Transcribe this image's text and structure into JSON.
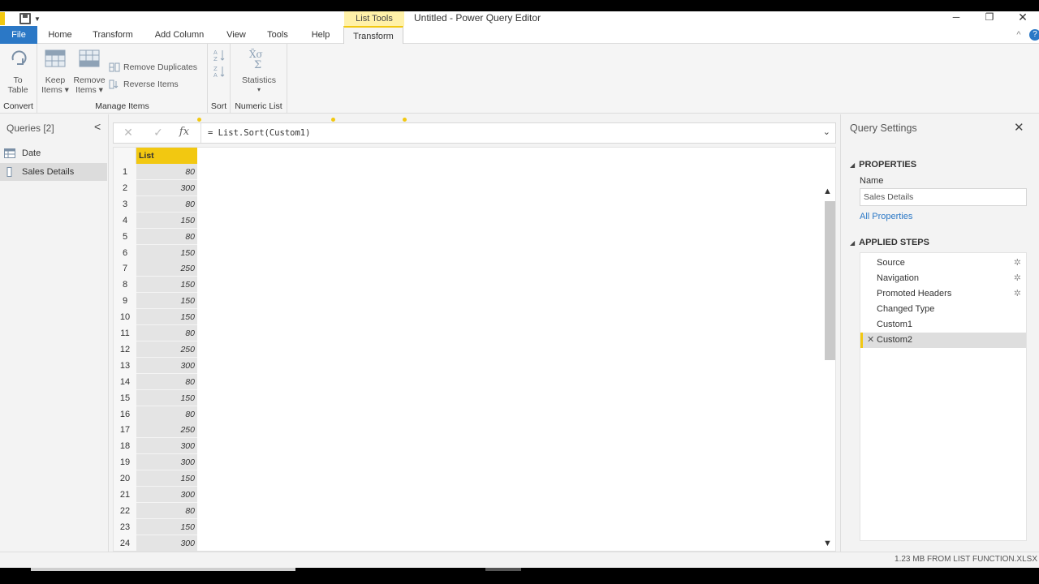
{
  "app": {
    "window_title": "Untitled - Power Query Editor",
    "context_tab_group": "List Tools",
    "window_buttons": {
      "minimize": "─",
      "restore": "❐",
      "close": "✕"
    }
  },
  "tabs": [
    {
      "label": "File"
    },
    {
      "label": "Home"
    },
    {
      "label": "Transform"
    },
    {
      "label": "Add Column"
    },
    {
      "label": "View"
    },
    {
      "label": "Tools"
    },
    {
      "label": "Help"
    },
    {
      "label": "Transform"
    }
  ],
  "ribbon": {
    "collapse_icon": "^",
    "help_icon": "?",
    "groups": {
      "convert": {
        "label": "Convert",
        "to_table": [
          "To",
          "Table"
        ]
      },
      "manage_items": {
        "label": "Manage Items",
        "keep_items": [
          "Keep",
          "Items ▾"
        ],
        "remove_items": [
          "Remove",
          "Items ▾"
        ],
        "remove_duplicates": "Remove Duplicates",
        "reverse_items": "Reverse Items"
      },
      "sort": {
        "label": "Sort"
      },
      "numeric_list": {
        "label": "Numeric List",
        "statistics": "Statistics",
        "statistics_dd": "▾"
      }
    }
  },
  "queries": {
    "title": "Queries [2]",
    "collapse": "<",
    "items": [
      {
        "label": "Date",
        "icon": "table-icon"
      },
      {
        "label": "Sales Details",
        "icon": "list-icon",
        "selected": true
      }
    ]
  },
  "formula_bar": {
    "cancel": "✕",
    "commit": "✓",
    "fx": "fx",
    "formula": "= List.Sort(Custom1)",
    "expand": "⌄"
  },
  "grid": {
    "column_header": "List",
    "rows": [
      {
        "n": "1",
        "v": "80"
      },
      {
        "n": "2",
        "v": "300"
      },
      {
        "n": "3",
        "v": "80"
      },
      {
        "n": "4",
        "v": "150"
      },
      {
        "n": "5",
        "v": "80"
      },
      {
        "n": "6",
        "v": "150"
      },
      {
        "n": "7",
        "v": "250"
      },
      {
        "n": "8",
        "v": "150"
      },
      {
        "n": "9",
        "v": "150"
      },
      {
        "n": "10",
        "v": "150"
      },
      {
        "n": "11",
        "v": "80"
      },
      {
        "n": "12",
        "v": "250"
      },
      {
        "n": "13",
        "v": "300"
      },
      {
        "n": "14",
        "v": "80"
      },
      {
        "n": "15",
        "v": "150"
      },
      {
        "n": "16",
        "v": "80"
      },
      {
        "n": "17",
        "v": "250"
      },
      {
        "n": "18",
        "v": "300"
      },
      {
        "n": "19",
        "v": "300"
      },
      {
        "n": "20",
        "v": "150"
      },
      {
        "n": "21",
        "v": "300"
      },
      {
        "n": "22",
        "v": "80"
      },
      {
        "n": "23",
        "v": "150"
      },
      {
        "n": "24",
        "v": "300"
      }
    ],
    "scroll_up": "▲",
    "scroll_down": "▼"
  },
  "settings": {
    "title": "Query Settings",
    "close": "✕",
    "properties_head": "PROPERTIES",
    "name_label": "Name",
    "name_value": "Sales Details",
    "all_properties": "All Properties",
    "steps_head": "APPLIED STEPS",
    "section_caret": "◢",
    "gear": "✲",
    "delete": "✕",
    "steps": [
      {
        "label": "Source",
        "has_gear": true
      },
      {
        "label": "Navigation",
        "has_gear": true
      },
      {
        "label": "Promoted Headers",
        "has_gear": true
      },
      {
        "label": "Changed Type",
        "has_gear": false
      },
      {
        "label": "Custom1",
        "has_gear": false
      },
      {
        "label": "Custom2",
        "has_gear": false,
        "selected": true
      }
    ]
  },
  "status": {
    "text": "1.23 MB FROM LIST FUNCTION.XLSX"
  },
  "colors": {
    "accent_yellow": "#f2c811",
    "file_blue": "#2b78c6"
  }
}
